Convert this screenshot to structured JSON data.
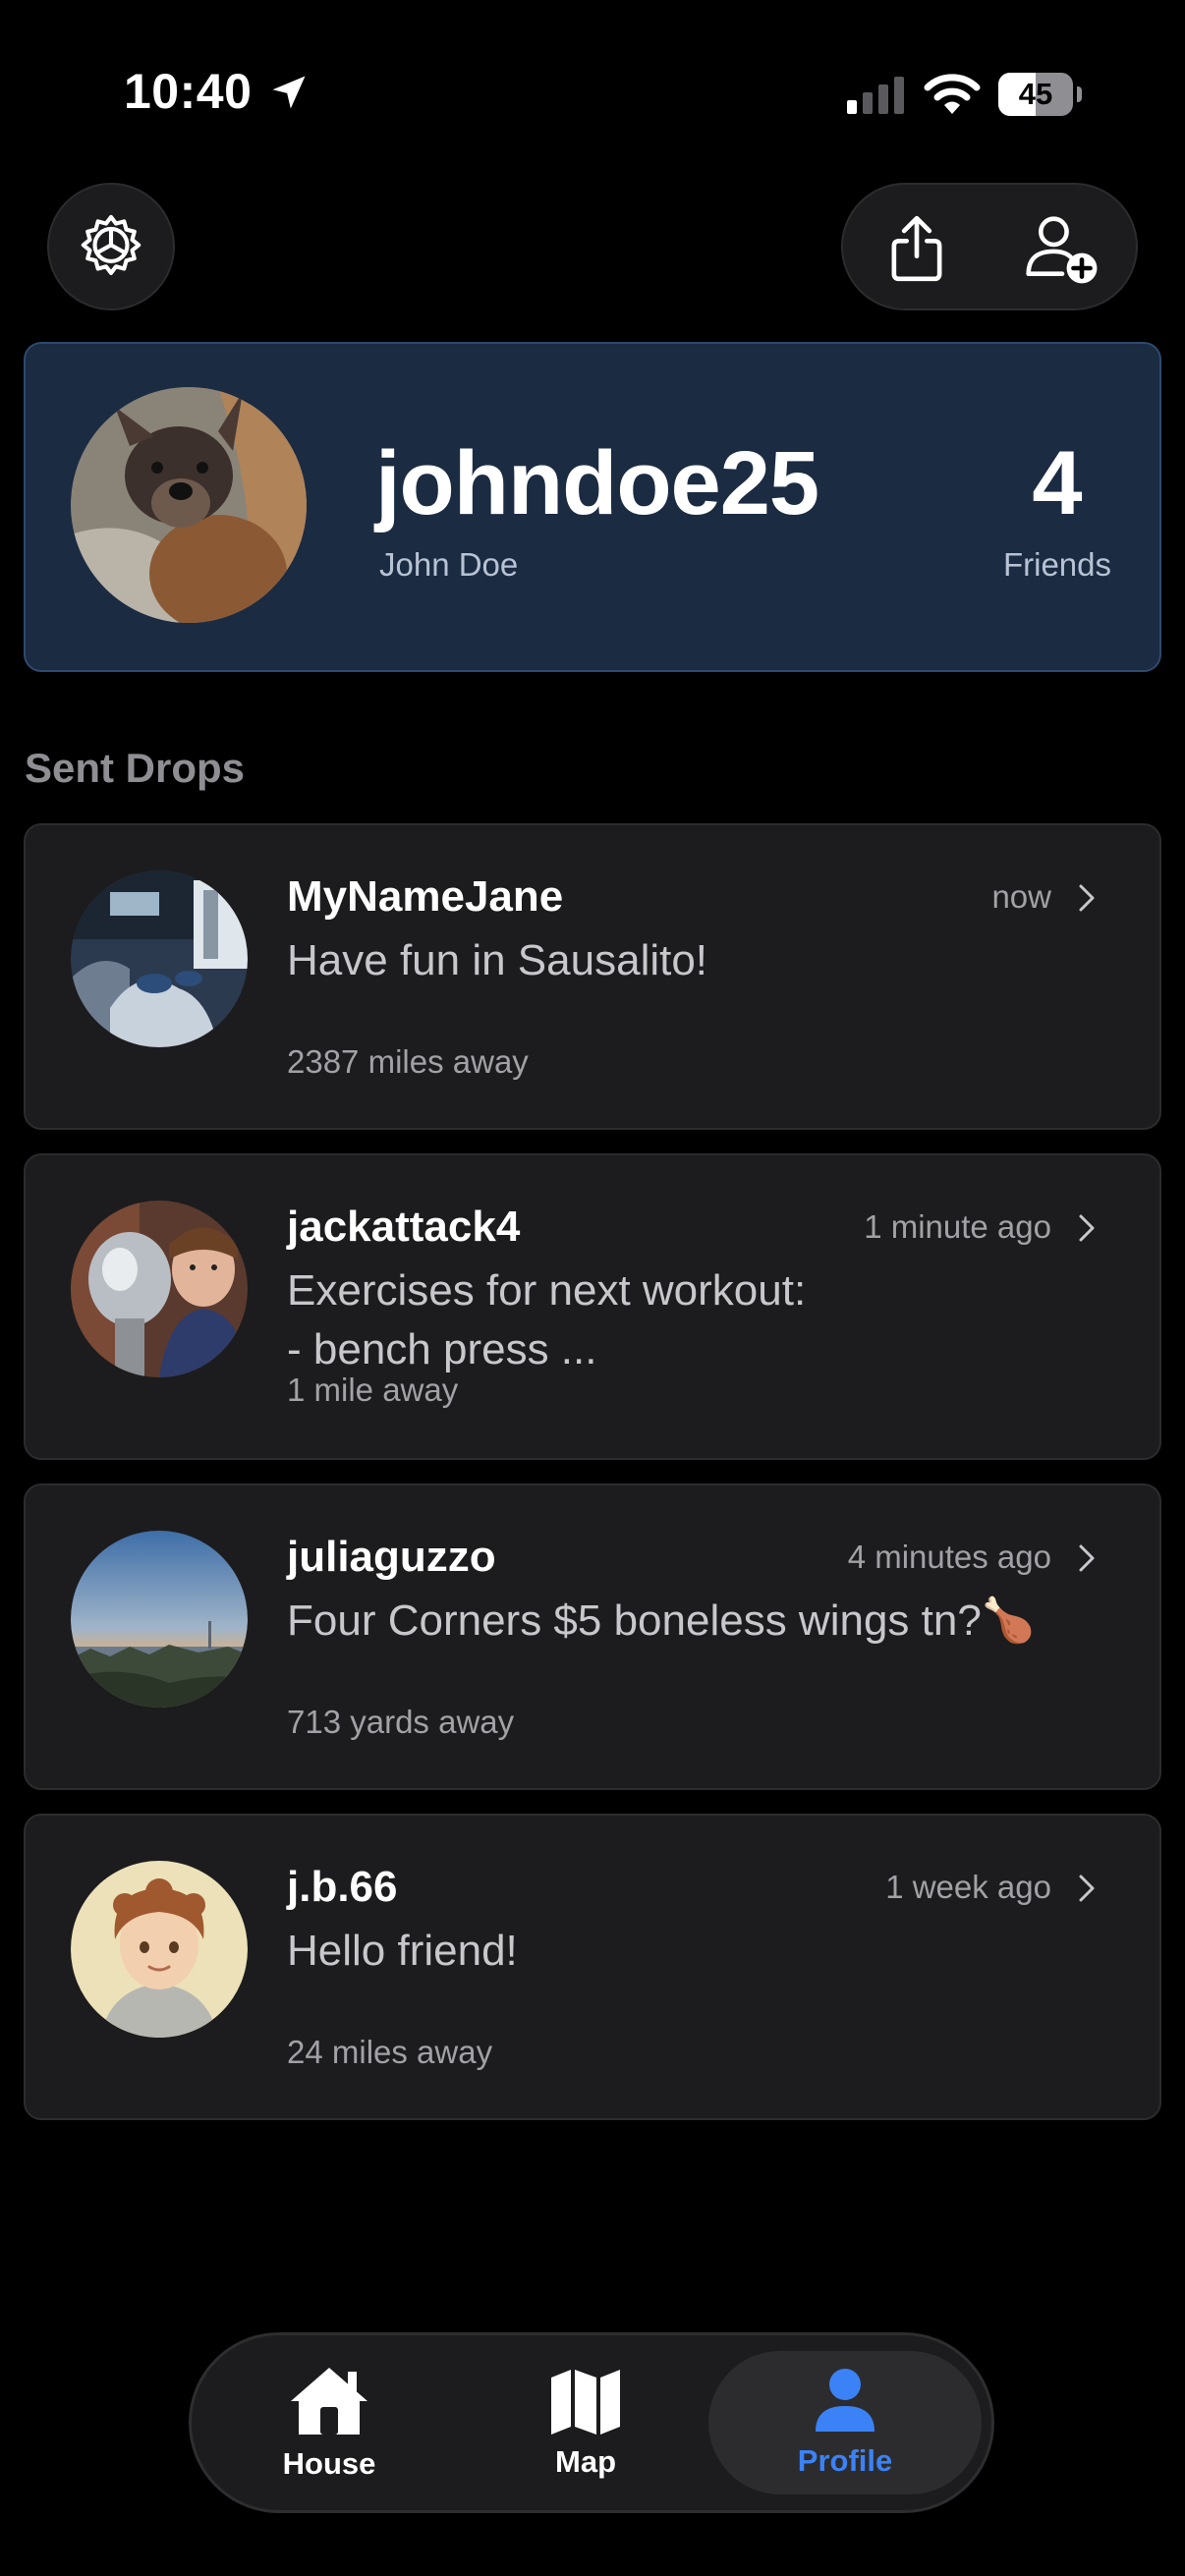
{
  "status_bar": {
    "time": "10:40",
    "battery": "45"
  },
  "header": {
    "settings_icon": "gear-icon",
    "share_icon": "share-icon",
    "add_friend_icon": "person-plus-icon"
  },
  "profile": {
    "username": "johndoe25",
    "display_name": "John Doe",
    "friends_count": "4",
    "friends_label": "Friends",
    "card_color": "#1b2b42"
  },
  "section": {
    "title": "Sent Drops"
  },
  "drops": [
    {
      "user": "MyNameJane",
      "time": "now",
      "message": "Have fun in Sausalito!",
      "distance": "2387 miles away"
    },
    {
      "user": "jackattack4",
      "time": "1 minute ago",
      "message": "Exercises for next workout:\n- bench press ...",
      "distance": "1 mile away"
    },
    {
      "user": "juliaguzzo",
      "time": "4 minutes ago",
      "message": "Four Corners $5 boneless wings tn?🍗",
      "distance": "713 yards away"
    },
    {
      "user": "j.b.66",
      "time": "1 week ago",
      "message": "Hello friend!",
      "distance": "24 miles away"
    }
  ],
  "tabbar": {
    "house_label": "House",
    "map_label": "Map",
    "profile_label": "Profile",
    "active_color": "#3b82f6"
  }
}
